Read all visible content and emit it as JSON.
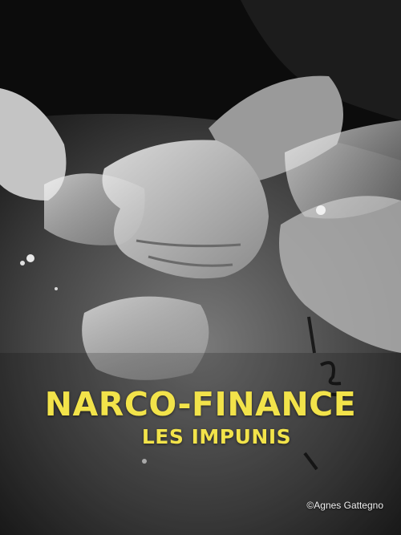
{
  "poster": {
    "title": "NARCO-FINANCE",
    "subtitle": "LES IMPUNIS",
    "credit": "©Agnes Gattegno",
    "accent_color": "#f2e34a"
  }
}
